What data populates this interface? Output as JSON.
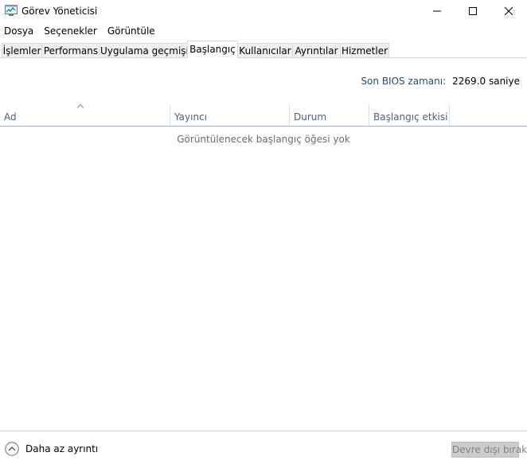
{
  "window": {
    "title": "Görev Yöneticisi",
    "icon": "task-manager-icon"
  },
  "menu": {
    "items": [
      "Dosya",
      "Seçenekler",
      "Görüntüle"
    ]
  },
  "tabs": {
    "items": [
      {
        "label": "İşlemler"
      },
      {
        "label": "Performans"
      },
      {
        "label": "Uygulama geçmişi"
      },
      {
        "label": "Başlangıç",
        "active": true
      },
      {
        "label": "Kullanıcılar"
      },
      {
        "label": "Ayrıntılar"
      },
      {
        "label": "Hizmetler"
      }
    ]
  },
  "bios": {
    "label": "Son BIOS zamanı:",
    "value": "2269.0 saniye"
  },
  "columns": {
    "items": [
      {
        "label": "Ad",
        "sorted": "ascending"
      },
      {
        "label": "Yayıncı"
      },
      {
        "label": "Durum"
      },
      {
        "label": "Başlangıç etkisi"
      }
    ]
  },
  "empty_message": "Görüntülenecek başlangıç öğesi yok",
  "footer": {
    "less_details_label": "Daha az ayrıntı",
    "disable_button_label": "Devre dışı bırak",
    "disable_button_enabled": false
  },
  "colors": {
    "bios_label": "#1e4e79",
    "column_header_text": "#4c607a",
    "empty_text": "#6d6d6d",
    "disabled_button_bg": "#cccccc",
    "disabled_button_text": "#838383"
  }
}
